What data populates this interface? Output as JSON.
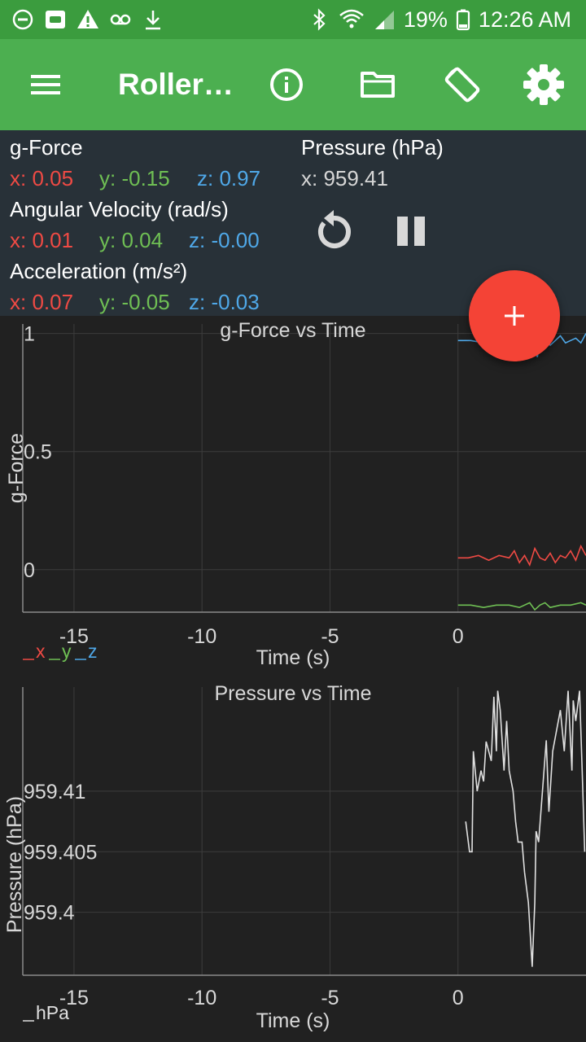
{
  "status_bar": {
    "battery": "19%",
    "time": "12:26 AM",
    "icons_left": [
      "do-not-disturb-icon",
      "media-icon",
      "warning-icon",
      "voicemail-icon",
      "download-icon"
    ],
    "icons_right": [
      "bluetooth-icon",
      "wifi-icon",
      "signal-icon",
      "battery-icon"
    ]
  },
  "app_bar": {
    "title": "Roller…",
    "actions": [
      "menu-icon",
      "info-icon",
      "folder-icon",
      "screen-rotation-icon",
      "settings-icon"
    ]
  },
  "readouts": {
    "gforce": {
      "label": "g-Force",
      "x": "x: 0.05",
      "y": "y: -0.15",
      "z": "z: 0.97"
    },
    "angular": {
      "label": "Angular Velocity (rad/s)",
      "x": "x: 0.01",
      "y": "y: 0.04",
      "z": "z: -0.00"
    },
    "accel": {
      "label": "Acceleration (m/s²)",
      "x": "x: 0.07",
      "y": "y: -0.05",
      "z": "z: -0.03"
    },
    "pressure": {
      "label": "Pressure (hPa)",
      "x": "x: 959.41"
    }
  },
  "controls": {
    "reset": "reset-icon",
    "pause": "pause-icon",
    "add": "add-icon"
  },
  "colors": {
    "x": "#ef4a44",
    "y": "#6fbf54",
    "z": "#4fa8e8",
    "pressure_line": "#e0e0e0"
  },
  "chart_data": [
    {
      "type": "line",
      "title": "g-Force vs Time",
      "xlabel": "Time (s)",
      "ylabel": "g-Force",
      "xlim": [
        -17,
        5
      ],
      "ylim": [
        -0.18,
        1.04
      ],
      "xticks": [
        -15,
        -10,
        -5,
        0
      ],
      "yticks": [
        1,
        0.5,
        0
      ],
      "legend": [
        "x",
        "y",
        "z"
      ],
      "series": [
        {
          "name": "x",
          "color": "#ef4a44",
          "x": [
            0,
            0.4,
            0.8,
            1.2,
            1.6,
            2.0,
            2.2,
            2.4,
            2.6,
            2.8,
            3.0,
            3.2,
            3.4,
            3.6,
            3.8,
            4.0,
            4.2,
            4.4,
            4.6,
            4.8,
            5.0
          ],
          "y": [
            0.05,
            0.05,
            0.06,
            0.04,
            0.06,
            0.05,
            0.08,
            0.03,
            0.06,
            0.02,
            0.09,
            0.05,
            0.04,
            0.07,
            0.03,
            0.06,
            0.05,
            0.08,
            0.04,
            0.1,
            0.06
          ]
        },
        {
          "name": "y",
          "color": "#6fbf54",
          "x": [
            0,
            0.5,
            1.0,
            1.5,
            2.0,
            2.4,
            2.8,
            3.0,
            3.2,
            3.4,
            3.6,
            4.0,
            4.4,
            4.8,
            5.0
          ],
          "y": [
            -0.15,
            -0.15,
            -0.16,
            -0.15,
            -0.15,
            -0.16,
            -0.14,
            -0.17,
            -0.15,
            -0.14,
            -0.16,
            -0.15,
            -0.15,
            -0.14,
            -0.15
          ]
        },
        {
          "name": "z",
          "color": "#4fa8e8",
          "x": [
            0,
            0.5,
            1.0,
            1.5,
            2.0,
            2.4,
            2.8,
            3.0,
            3.1,
            3.2,
            3.4,
            3.6,
            3.8,
            4.0,
            4.2,
            4.4,
            4.6,
            4.8,
            5.0
          ],
          "y": [
            0.97,
            0.97,
            0.96,
            0.97,
            0.97,
            0.98,
            0.97,
            0.94,
            0.9,
            0.96,
            0.98,
            0.95,
            0.97,
            0.99,
            0.96,
            0.97,
            0.98,
            0.96,
            1.0
          ]
        }
      ]
    },
    {
      "type": "line",
      "title": "Pressure vs Time",
      "xlabel": "Time (s)",
      "ylabel": "Pressure (hPa)",
      "xlim": [
        -17,
        5
      ],
      "ylim": [
        959.3948,
        959.4186
      ],
      "xticks": [
        -15,
        -10,
        -5,
        0
      ],
      "yticks": [
        959.41,
        959.405,
        959.4
      ],
      "ytick_labels": [
        "959.41",
        "959.405",
        "959.4"
      ],
      "legend": [
        "hPa"
      ],
      "series": [
        {
          "name": "hPa",
          "color": "#e0e0e0",
          "x": [
            0.3,
            0.45,
            0.55,
            0.6,
            0.75,
            0.9,
            1.0,
            1.1,
            1.3,
            1.4,
            1.5,
            1.55,
            1.65,
            1.8,
            1.9,
            2.0,
            2.15,
            2.25,
            2.35,
            2.5,
            2.6,
            2.75,
            2.9,
            3.0,
            3.05,
            3.15,
            3.3,
            3.45,
            3.55,
            3.7,
            3.85,
            4.0,
            4.15,
            4.3,
            4.45,
            4.5,
            4.6,
            4.75,
            4.85,
            4.95
          ],
          "y": [
            959.4075,
            959.405,
            959.405,
            959.4133,
            959.41,
            959.4117,
            959.4108,
            959.4141,
            959.4125,
            959.4178,
            959.4133,
            959.4183,
            959.4167,
            959.4117,
            959.4158,
            959.4117,
            959.41,
            959.4075,
            959.4058,
            959.4058,
            959.4033,
            959.4008,
            959.3955,
            959.4008,
            959.4067,
            959.4058,
            959.41,
            959.4142,
            959.4083,
            959.4133,
            959.415,
            959.4167,
            959.4133,
            959.4183,
            959.4117,
            959.4175,
            959.4158,
            959.4183,
            959.4117,
            959.405
          ]
        }
      ]
    }
  ]
}
